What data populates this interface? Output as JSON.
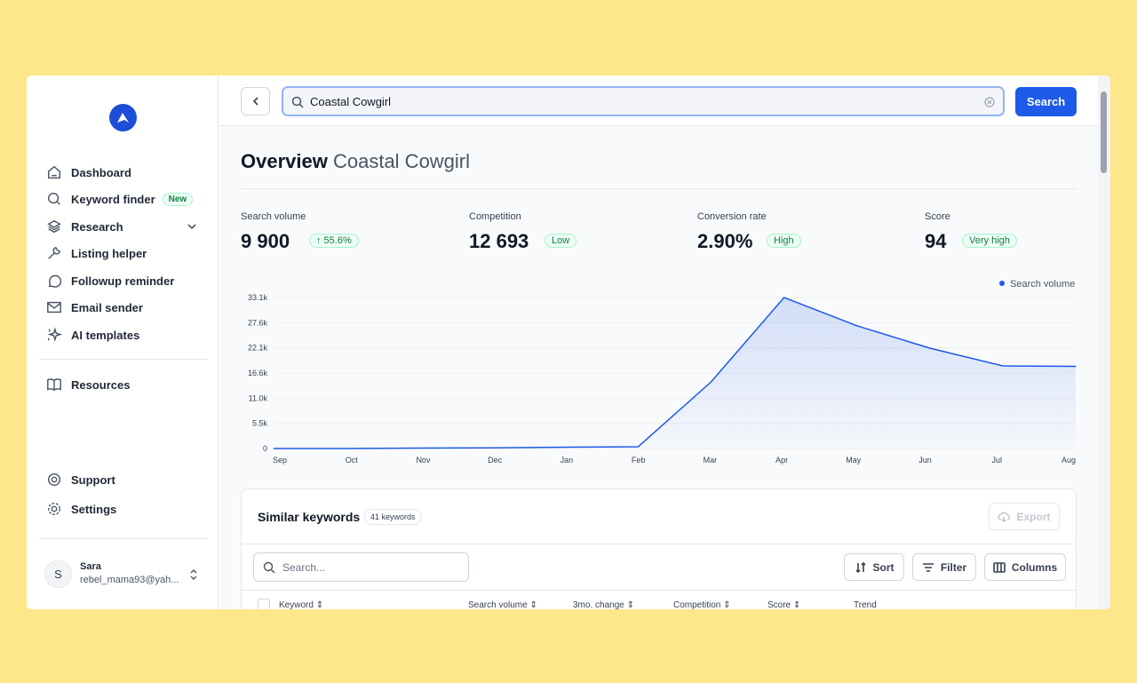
{
  "sidebar": {
    "items": [
      {
        "label": "Dashboard",
        "icon": "home-icon"
      },
      {
        "label": "Keyword finder",
        "icon": "search-icon",
        "badge": "New"
      },
      {
        "label": "Research",
        "icon": "layers-icon"
      },
      {
        "label": "Listing helper",
        "icon": "wrench-icon"
      },
      {
        "label": "Followup reminder",
        "icon": "chat-icon"
      },
      {
        "label": "Email sender",
        "icon": "mail-icon"
      },
      {
        "label": "AI templates",
        "icon": "sparkles-icon"
      },
      {
        "label": "Resources",
        "icon": "book-icon"
      },
      {
        "label": "Support",
        "icon": "lifebuoy-icon"
      },
      {
        "label": "Settings",
        "icon": "gear-icon"
      }
    ],
    "user": {
      "initial": "S",
      "name": "Sara",
      "email": "rebel_mama93@yah..."
    }
  },
  "search": {
    "value": "Coastal Cowgirl",
    "button": "Search"
  },
  "overview": {
    "title": "Overview",
    "keyword": "Coastal Cowgirl"
  },
  "stats": [
    {
      "label": "Search volume",
      "value": "9 900",
      "badge": "↑ 55.6%"
    },
    {
      "label": "Competition",
      "value": "12 693",
      "badge": "Low"
    },
    {
      "label": "Conversion rate",
      "value": "2.90%",
      "badge": "High"
    },
    {
      "label": "Score",
      "value": "94",
      "badge": "Very high"
    }
  ],
  "colors": {
    "accent": "#1d5ae8",
    "good": "#15803d"
  },
  "chart_data": {
    "type": "area",
    "categories": [
      "Sep",
      "Oct",
      "Nov",
      "Dec",
      "Jan",
      "Feb",
      "Mar",
      "Apr",
      "May",
      "Jun",
      "Jul",
      "Aug"
    ],
    "series": [
      {
        "name": "Search volume",
        "values": [
          0,
          0,
          100,
          150,
          300,
          400,
          14600,
          33100,
          26900,
          22000,
          18100,
          18000
        ]
      }
    ],
    "yticks": [
      "0",
      "5.5k",
      "11.0k",
      "16.6k",
      "22.1k",
      "27.6k",
      "33.1k"
    ],
    "ylim": [
      0,
      33100
    ],
    "legend": "top-right",
    "grid": true
  },
  "similar": {
    "title": "Similar keywords",
    "count": "41 keywords",
    "export": "Export",
    "search_placeholder": "Search...",
    "sort": "Sort",
    "filter": "Filter",
    "columns": "Columns",
    "headers": [
      "Keyword",
      "Search volume",
      "3mo. change",
      "Competition",
      "Score",
      "Trend"
    ]
  }
}
